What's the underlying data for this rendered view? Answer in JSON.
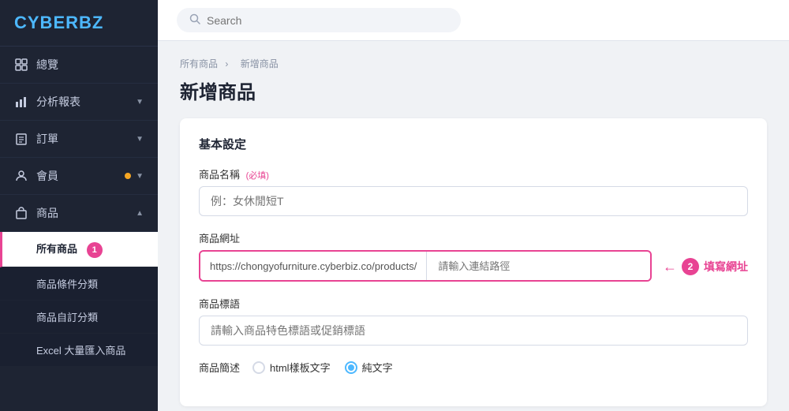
{
  "logo": {
    "text1": "CYBERB",
    "text2": "Z"
  },
  "sidebar": {
    "items": [
      {
        "id": "overview",
        "label": "總覽",
        "icon": "grid-icon",
        "arrow": false,
        "badge": false
      },
      {
        "id": "analytics",
        "label": "分析報表",
        "icon": "chart-icon",
        "arrow": true,
        "badge": false
      },
      {
        "id": "orders",
        "label": "訂單",
        "icon": "clipboard-icon",
        "arrow": true,
        "badge": false
      },
      {
        "id": "members",
        "label": "會員",
        "icon": "user-icon",
        "arrow": true,
        "badge": true
      },
      {
        "id": "products",
        "label": "商品",
        "icon": "bag-icon",
        "arrow": true,
        "badge": false,
        "expanded": true
      }
    ],
    "subItems": [
      {
        "id": "all-products",
        "label": "所有商品",
        "active": true,
        "badge": "1"
      },
      {
        "id": "category",
        "label": "商品條件分類",
        "active": false
      },
      {
        "id": "custom-category",
        "label": "商品自訂分類",
        "active": false
      },
      {
        "id": "excel-import",
        "label": "Excel 大量匯入商品",
        "active": false
      }
    ]
  },
  "topbar": {
    "search_placeholder": "Search"
  },
  "breadcrumb": {
    "parent": "所有商品",
    "separator": "›",
    "current": "新增商品"
  },
  "page": {
    "title": "新增商品"
  },
  "card": {
    "title": "基本設定",
    "product_name_label": "商品名稱",
    "product_name_required": "(必填)",
    "product_name_placeholder": "例：女休閒短T",
    "url_label": "商品網址",
    "url_prefix": "https://chongyofurniture.cyberbiz.co/products/",
    "url_placeholder": "請輸入連結路徑",
    "slogan_label": "商品標語",
    "slogan_placeholder": "請輸入商品特色標語或促銷標語",
    "description_label": "商品簡述",
    "description_options": [
      {
        "id": "html",
        "label": "html樣板文字",
        "selected": false
      },
      {
        "id": "plain",
        "label": "純文字",
        "selected": true
      }
    ]
  },
  "annotation": {
    "num": "2",
    "text": "填寫網址"
  }
}
